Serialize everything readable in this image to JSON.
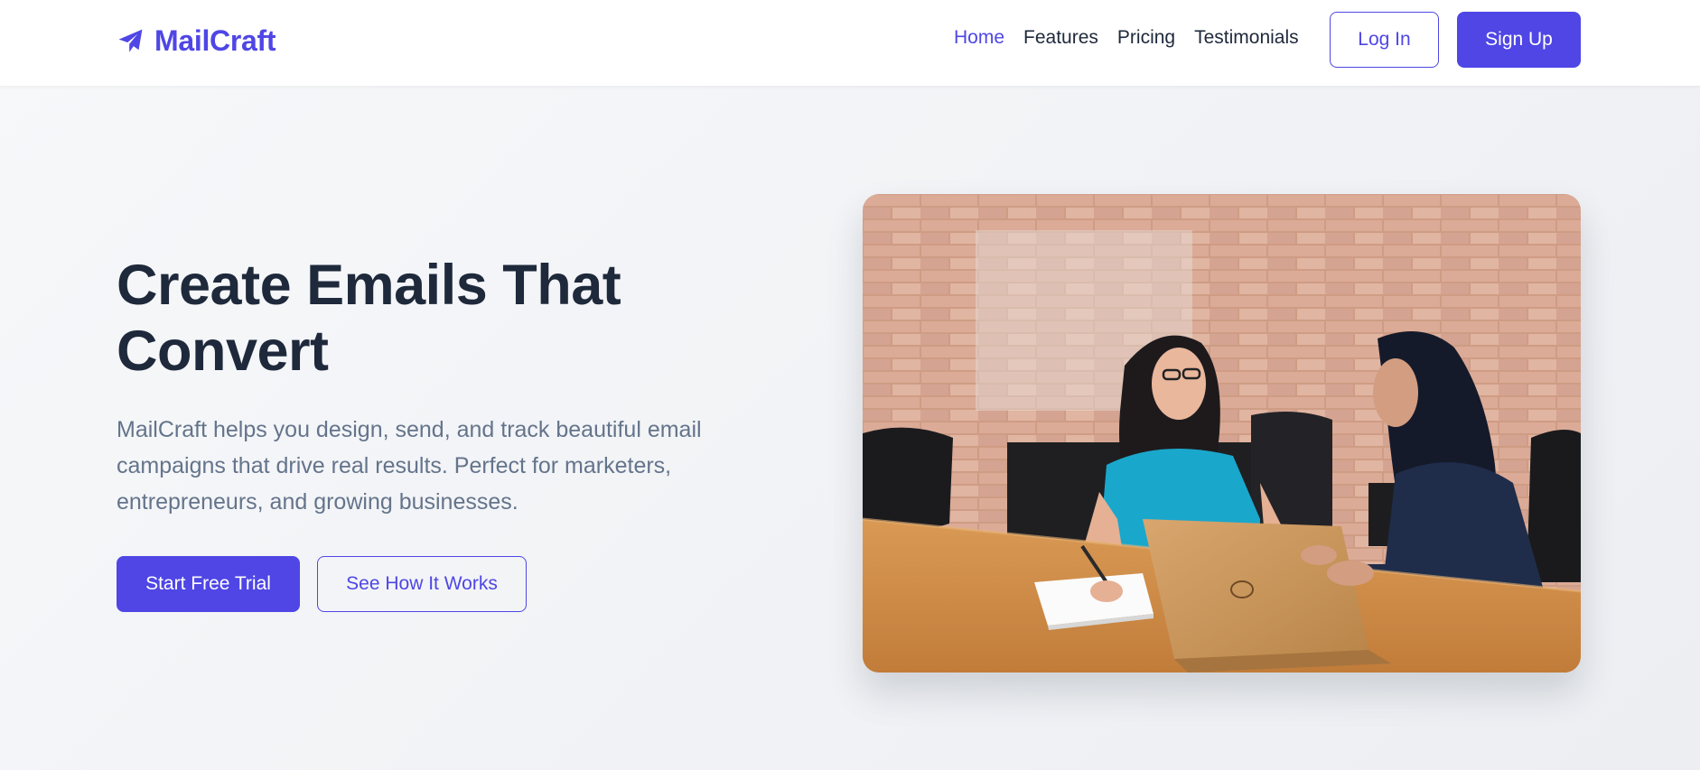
{
  "brand": {
    "name": "MailCraft",
    "color": "#4f46e5",
    "icon": "paper-plane-icon"
  },
  "nav": {
    "links": [
      {
        "label": "Home",
        "active": true
      },
      {
        "label": "Features",
        "active": false
      },
      {
        "label": "Pricing",
        "active": false
      },
      {
        "label": "Testimonials",
        "active": false
      }
    ],
    "login_label": "Log In",
    "signup_label": "Sign Up"
  },
  "hero": {
    "title": "Create Emails That Convert",
    "description": "MailCraft helps you design, send, and track beautiful email campaigns that drive real results. Perfect for marketers, entrepreneurs, and growing businesses.",
    "primary_cta": "Start Free Trial",
    "secondary_cta": "See How It Works",
    "image_subject": "two women talking at a wooden conference table with a laptop, brick wall background"
  },
  "colors": {
    "primary": "#4f46e5",
    "heading": "#1e293b",
    "body_text": "#64748b",
    "nav_text": "#1e293b"
  }
}
